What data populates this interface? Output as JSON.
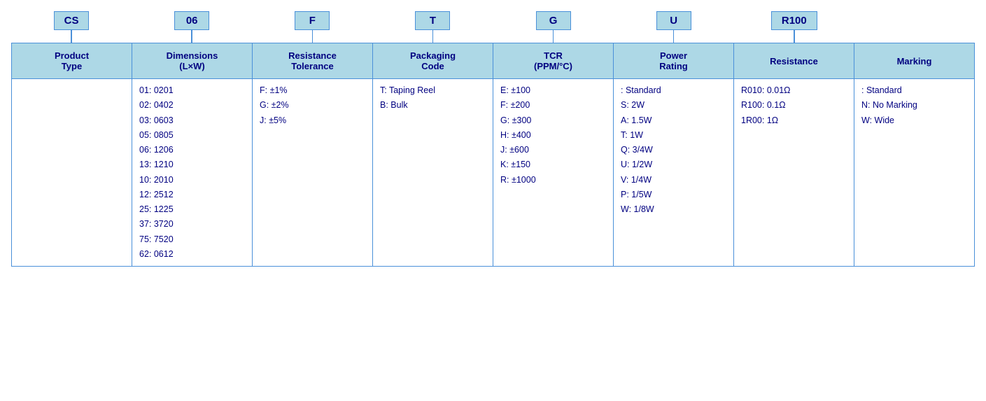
{
  "columns": [
    {
      "code": "CS",
      "header": "Product\nType",
      "items": []
    },
    {
      "code": "06",
      "header": "Dimensions\n(L×W)",
      "items": [
        "01: 0201",
        "02: 0402",
        "03: 0603",
        "05: 0805",
        "06: 1206",
        "13: 1210",
        "10: 2010",
        "12: 2512",
        "25: 1225",
        "37: 3720",
        "75: 7520",
        "62: 0612"
      ]
    },
    {
      "code": "F",
      "header": "Resistance\nTolerance",
      "items": [
        "F: ±1%",
        "G: ±2%",
        "J: ±5%"
      ]
    },
    {
      "code": "T",
      "header": "Packaging\nCode",
      "items": [
        "T: Taping Reel",
        "B: Bulk"
      ]
    },
    {
      "code": "G",
      "header": "TCR\n(PPM/°C)",
      "items": [
        "E: ±100",
        "F: ±200",
        "G: ±300",
        "H: ±400",
        "J: ±600",
        "K: ±150",
        "R: ±1000"
      ]
    },
    {
      "code": "U",
      "header": "Power\nRating",
      "items": [
        " : Standard",
        "S: 2W",
        "A: 1.5W",
        "T: 1W",
        "Q: 3/4W",
        "U: 1/2W",
        "V: 1/4W",
        "P: 1/5W",
        "W: 1/8W"
      ]
    },
    {
      "code": "R100",
      "header": "Resistance",
      "items": [
        "R010: 0.01Ω",
        "R100: 0.1Ω",
        "1R00: 1Ω"
      ]
    },
    {
      "code": "",
      "header": "Marking",
      "items": [
        " : Standard",
        "N: No Marking",
        "W: Wide"
      ]
    }
  ]
}
